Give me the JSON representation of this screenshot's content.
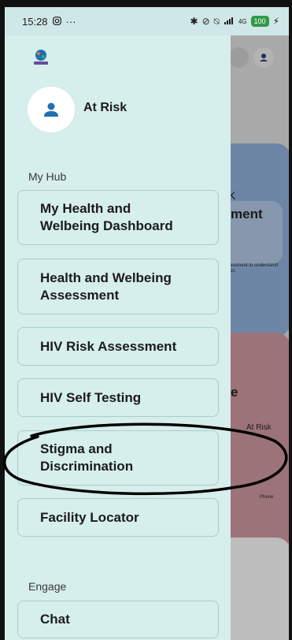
{
  "status_bar": {
    "time": "15:28",
    "network_label": "4G",
    "battery": "100"
  },
  "profile": {
    "name": "At Risk"
  },
  "sections": {
    "my_hub": "My Hub",
    "engage": "Engage"
  },
  "menu": {
    "dashboard": "My Health and\nWelbeing Dashboard",
    "assessment": "Health and Welbeing\nAssessment",
    "hiv_risk": "HIV Risk Assessment",
    "hiv_self_testing": "HIV Self Testing",
    "stigma": "Stigma and\nDiscrimination",
    "facility": "Facility  Locator",
    "chat": "Chat"
  },
  "background": {
    "card_title_fragment": "ment",
    "card_letter_k": "K",
    "card_small_text": "essment to understand\nus.",
    "card2_letter": "e",
    "card2_label": "At Risk",
    "card2_phone": "Phone"
  },
  "colors": {
    "drawer_bg": "#d6eeec",
    "button_border": "#a7cfcb",
    "accent_icon": "#1e6fb5",
    "annotation": "#000000"
  }
}
